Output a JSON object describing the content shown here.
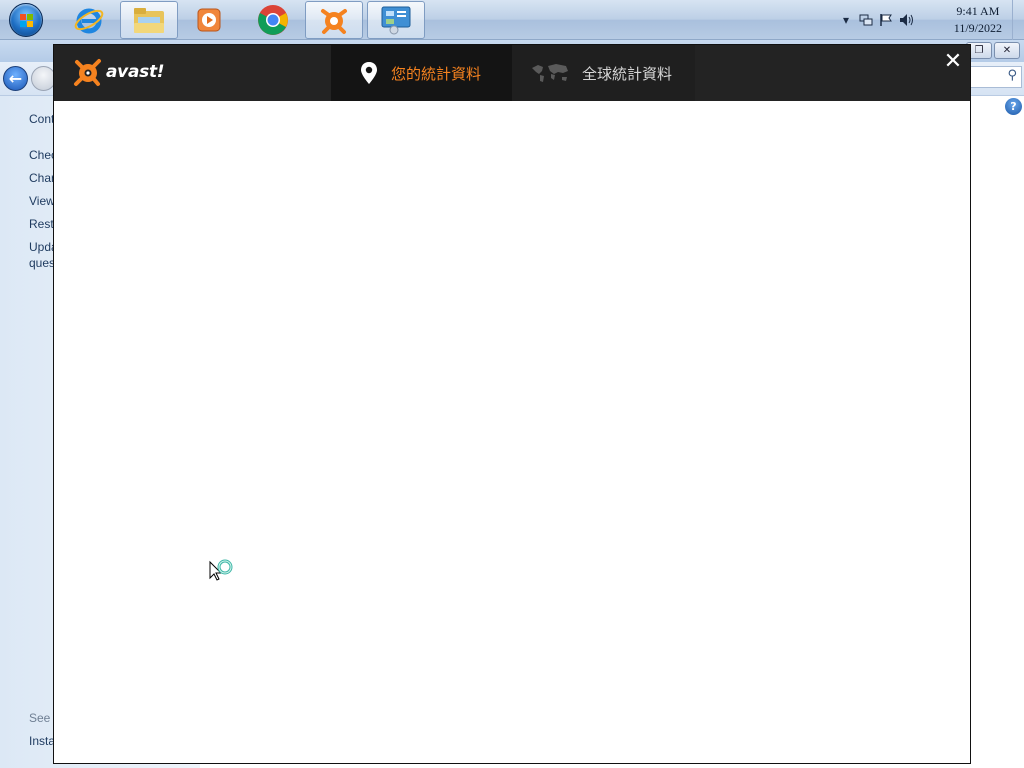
{
  "taskbar": {
    "start_label": "Start",
    "pinned": [
      {
        "name": "internet-explorer"
      },
      {
        "name": "windows-explorer"
      },
      {
        "name": "windows-media-player"
      },
      {
        "name": "google-chrome"
      },
      {
        "name": "avast"
      },
      {
        "name": "control-panel"
      }
    ],
    "clock_time": "9:41 AM",
    "clock_date": "11/9/2022"
  },
  "background_window": {
    "left_links": [
      "Cont",
      "Chec",
      "Char",
      "View",
      "Resto",
      "Upda",
      "ques"
    ],
    "see_also": "See a",
    "bottom_link": "Insta"
  },
  "avast": {
    "brand": "avast!",
    "tabs": [
      {
        "label": "您的統計資料",
        "active": true,
        "icon": "location-pin-icon"
      },
      {
        "label": "全球統計資料",
        "active": false,
        "icon": "world-map-icon"
      }
    ],
    "close_symbol": "✕",
    "accent_color": "#f5821f"
  }
}
